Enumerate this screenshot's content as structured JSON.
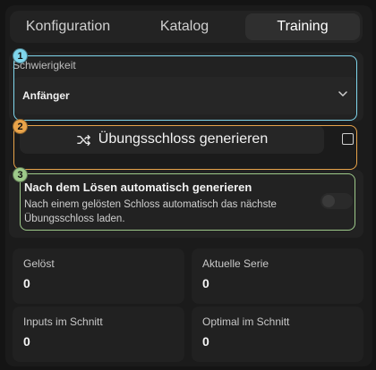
{
  "tabs": [
    {
      "label": "Konfiguration",
      "active": false
    },
    {
      "label": "Katalog",
      "active": false
    },
    {
      "label": "Training",
      "active": true
    }
  ],
  "difficulty": {
    "label": "Schwierigkeit",
    "selected": "Anfänger"
  },
  "generate_button": {
    "label": "Übungsschloss generieren",
    "icon": "shuffle-icon"
  },
  "auto_generate": {
    "title": "Nach dem Lösen automatisch generieren",
    "description": "Nach einem gelösten Schloss automatisch das nächste Übungsschloss laden.",
    "enabled": false
  },
  "stats": [
    {
      "label": "Gelöst",
      "value": "0"
    },
    {
      "label": "Aktuelle Serie",
      "value": "0"
    },
    {
      "label": "Inputs im Schnitt",
      "value": "0"
    },
    {
      "label": "Optimal im Schnitt",
      "value": "0"
    }
  ],
  "callouts": [
    {
      "number": "1",
      "color": "#7fd6ec"
    },
    {
      "number": "2",
      "color": "#e8a34a"
    },
    {
      "number": "3",
      "color": "#9dc98a"
    }
  ]
}
